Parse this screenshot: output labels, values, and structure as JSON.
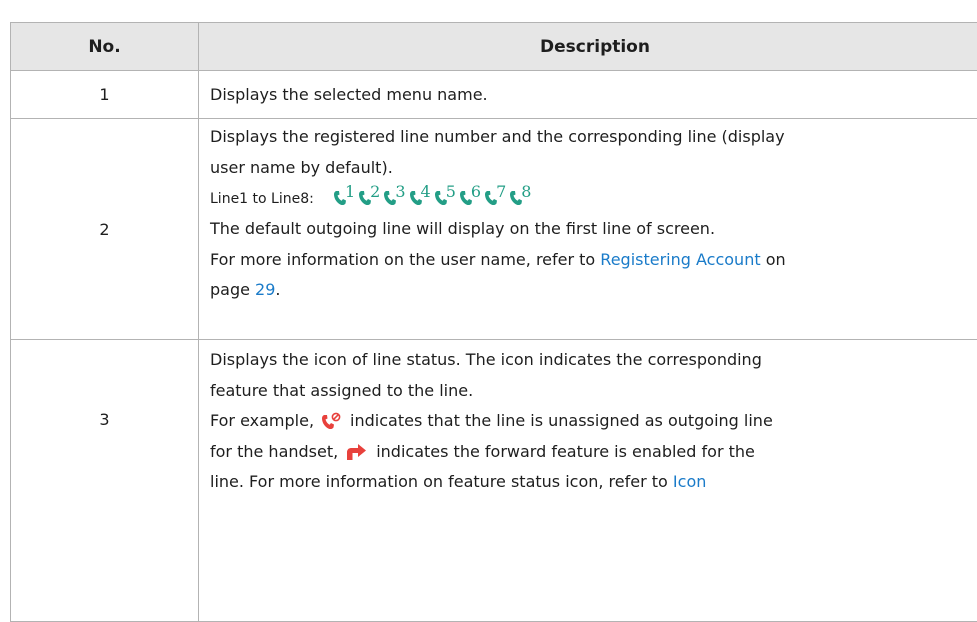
{
  "table": {
    "headers": {
      "no": "No.",
      "description": "Description"
    },
    "row1": {
      "no": "1",
      "text": "Displays the selected menu name."
    },
    "row2": {
      "no": "2",
      "l1": "Displays the registered line number and the corresponding line (display",
      "l2": "user name by default).",
      "l3_label": "Line1 to Line8:",
      "line_icons": [
        "1",
        "2",
        "3",
        "4",
        "5",
        "6",
        "7",
        "8"
      ],
      "l4": "The default outgoing line will display on the first line of screen.",
      "l5_pre": "For more information on the user name, refer to ",
      "l5_link": "Registering Account",
      "l5_post": " on",
      "l6_pre": "page ",
      "l6_link": "29",
      "l6_post": "."
    },
    "row3": {
      "no": "3",
      "l1": "Displays the icon of line status. The icon indicates the corresponding",
      "l2": "feature that assigned to the line.",
      "l3_pre": "For example,",
      "l3_post": "indicates that the line is unassigned as outgoing line",
      "l4_pre": "for the handset,",
      "l4_post": "indicates the forward feature is enabled for the",
      "l5_pre": "line. For more information on feature status icon, refer to ",
      "l5_link": "Icon"
    }
  },
  "colors": {
    "header_bg": "#e6e6e6",
    "link": "#1a7bc9",
    "line_icon": "#239e86",
    "status_icon": "#e8413c"
  }
}
